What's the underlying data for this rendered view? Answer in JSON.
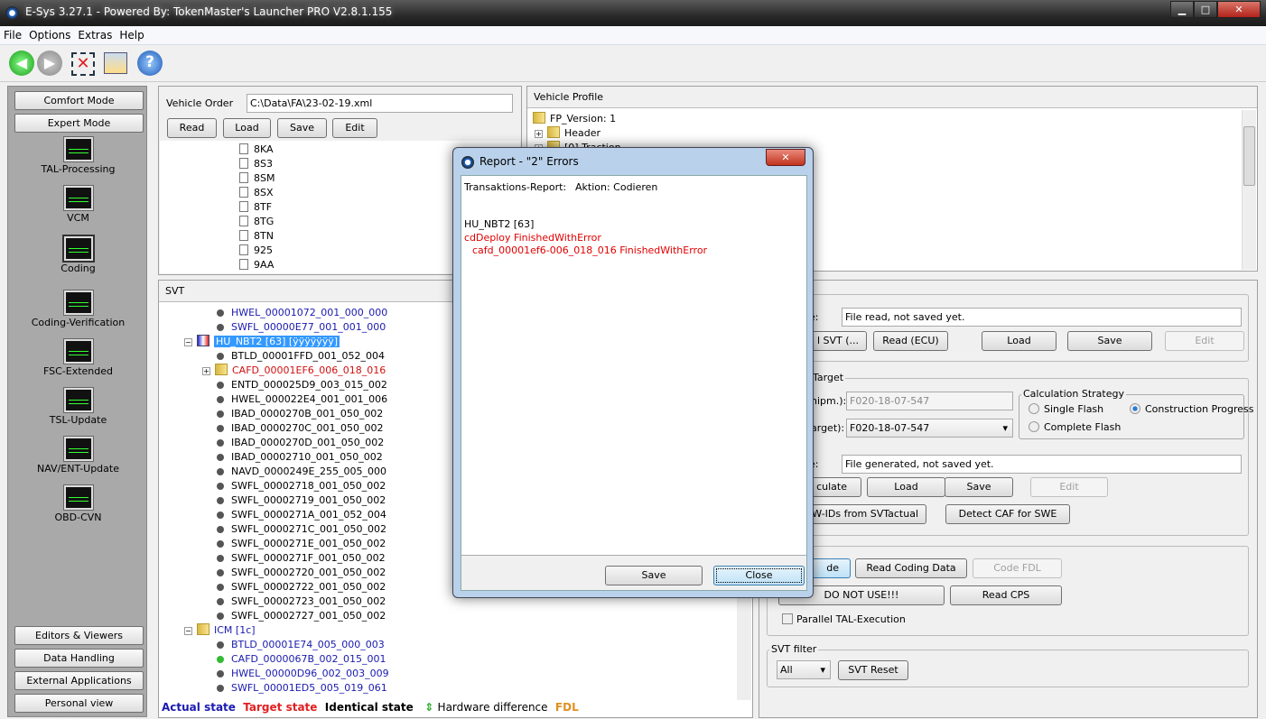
{
  "window": {
    "title": "E-Sys 3.27.1 - Powered By: TokenMaster's Launcher PRO V2.8.1.155",
    "min": "▁",
    "max": "□",
    "close": "✕"
  },
  "menu": [
    "File",
    "Options",
    "Extras",
    "Help"
  ],
  "sidebar": {
    "top_buttons": [
      "Comfort Mode",
      "Expert Mode"
    ],
    "items": [
      "TAL-Processing",
      "VCM",
      "Coding",
      "Coding-Verification",
      "FSC-Extended",
      "TSL-Update",
      "NAV/ENT-Update",
      "OBD-CVN"
    ],
    "selected": "Coding",
    "bottom_buttons": [
      "Editors & Viewers",
      "Data Handling",
      "External Applications",
      "Personal view"
    ]
  },
  "vehicle_order": {
    "label": "Vehicle Order",
    "path": "C:\\Data\\FA\\23-02-19.xml",
    "buttons": [
      "Read",
      "Load",
      "Save",
      "Edit"
    ],
    "items": [
      "8KA",
      "8S3",
      "8SM",
      "8SX",
      "8TF",
      "8TG",
      "8TN",
      "925",
      "9AA"
    ]
  },
  "vehicle_profile": {
    "title": "Vehicle Profile",
    "items": [
      "FP_Version: 1",
      "Header",
      "[0] Traction"
    ]
  },
  "svt": {
    "title": "SVT",
    "rows": [
      {
        "text": "HWEL_00001072_001_000_000",
        "color": "#1a1ab0",
        "icon": "dot",
        "level": 2
      },
      {
        "text": "SWFL_00000E77_001_001_000",
        "color": "#1a1ab0",
        "icon": "dot",
        "level": 2
      },
      {
        "text": "HU_NBT2 [63] [ÿÿÿÿÿÿÿ]",
        "color": "#ffffff",
        "icon": "ecu",
        "level": 1,
        "selected": true
      },
      {
        "text": "BTLD_00001FFD_001_052_004",
        "color": "#000000",
        "icon": "dot",
        "level": 2
      },
      {
        "text": "CAFD_00001EF6_006_018_016",
        "color": "#d01010",
        "icon": "folder",
        "level": 2,
        "expandable": true
      },
      {
        "text": "ENTD_000025D9_003_015_002",
        "color": "#000000",
        "icon": "dot",
        "level": 2
      },
      {
        "text": "HWEL_000022E4_001_001_006",
        "color": "#000000",
        "icon": "dot",
        "level": 2
      },
      {
        "text": "IBAD_0000270B_001_050_002",
        "color": "#000000",
        "icon": "dot",
        "level": 2
      },
      {
        "text": "IBAD_0000270C_001_050_002",
        "color": "#000000",
        "icon": "dot",
        "level": 2
      },
      {
        "text": "IBAD_0000270D_001_050_002",
        "color": "#000000",
        "icon": "dot",
        "level": 2
      },
      {
        "text": "IBAD_00002710_001_050_002",
        "color": "#000000",
        "icon": "dot",
        "level": 2
      },
      {
        "text": "NAVD_0000249E_255_005_000",
        "color": "#000000",
        "icon": "dot",
        "level": 2
      },
      {
        "text": "SWFL_00002718_001_050_002",
        "color": "#000000",
        "icon": "dot",
        "level": 2
      },
      {
        "text": "SWFL_00002719_001_050_002",
        "color": "#000000",
        "icon": "dot",
        "level": 2
      },
      {
        "text": "SWFL_0000271A_001_052_004",
        "color": "#000000",
        "icon": "dot",
        "level": 2
      },
      {
        "text": "SWFL_0000271C_001_050_002",
        "color": "#000000",
        "icon": "dot",
        "level": 2
      },
      {
        "text": "SWFL_0000271E_001_050_002",
        "color": "#000000",
        "icon": "dot",
        "level": 2
      },
      {
        "text": "SWFL_0000271F_001_050_002",
        "color": "#000000",
        "icon": "dot",
        "level": 2
      },
      {
        "text": "SWFL_00002720_001_050_002",
        "color": "#000000",
        "icon": "dot",
        "level": 2
      },
      {
        "text": "SWFL_00002722_001_050_002",
        "color": "#000000",
        "icon": "dot",
        "level": 2
      },
      {
        "text": "SWFL_00002723_001_050_002",
        "color": "#000000",
        "icon": "dot",
        "level": 2
      },
      {
        "text": "SWFL_00002727_001_050_002",
        "color": "#000000",
        "icon": "dot",
        "level": 2
      },
      {
        "text": "ICM [1c]",
        "color": "#1a1ab0",
        "icon": "folder",
        "level": 1
      },
      {
        "text": "BTLD_00001E74_005_000_003",
        "color": "#1a1ab0",
        "icon": "dot",
        "level": 2
      },
      {
        "text": "CAFD_0000067B_002_015_001",
        "color": "#1a1ab0",
        "icon": "greendot",
        "level": 2
      },
      {
        "text": "HWEL_00000D96_002_003_009",
        "color": "#1a1ab0",
        "icon": "dot",
        "level": 2
      },
      {
        "text": "SWFL_00001ED5_005_019_061",
        "color": "#1a1ab0",
        "icon": "dot",
        "level": 2
      }
    ],
    "legend": [
      {
        "text": "Actual state",
        "color": "#1a1ab0"
      },
      {
        "text": "Target state",
        "color": "#e02020"
      },
      {
        "text": "Identical state",
        "color": "#000000"
      },
      {
        "text": "Hardware difference",
        "color": "#000000"
      },
      {
        "text": "FDL",
        "color": "#e09020"
      }
    ]
  },
  "right": {
    "actual": {
      "label": "al",
      "status_label": "e:",
      "status": "File read, not saved yet.",
      "buttons": [
        "l SVT (...",
        "Read (ECU)",
        "Load",
        "Save",
        "Edit"
      ]
    },
    "target": {
      "label": "Target",
      "shipm_label": "hipm.):",
      "shipm_value": "F020-18-07-547",
      "target_label": "arget):",
      "target_value": "F020-18-07-547",
      "strategy": {
        "label": "Calculation Strategy",
        "options": [
          "Single Flash",
          "Construction Progress",
          "Complete Flash"
        ],
        "selected": "Construction Progress"
      },
      "status_label": "e:",
      "status": "File generated, not saved yet.",
      "buttons": [
        "culate",
        "Load",
        "Save",
        "Edit"
      ],
      "buttons2": [
        "W-IDs from SVTactual",
        "Detect CAF for SWE"
      ]
    },
    "coding": {
      "buttons": [
        "de",
        "Read Coding Data",
        "Code FDL",
        "DO NOT USE!!!",
        "Read CPS"
      ],
      "checkbox": "Parallel TAL-Execution",
      "checked": false
    },
    "filter": {
      "label": "SVT filter",
      "value": "All",
      "reset": "SVT Reset"
    }
  },
  "dialog": {
    "title": "Report - \"2\" Errors",
    "close": "✕",
    "header1": "Transaktions-Report:",
    "header2": "Aktion: Codieren",
    "ecu": "HU_NBT2 [63]",
    "line1": "cdDeploy FinishedWithError",
    "line2": "cafd_00001ef6-006_018_016 FinishedWithError",
    "error_color": "#e00000",
    "save": "Save",
    "close_btn": "Close"
  }
}
